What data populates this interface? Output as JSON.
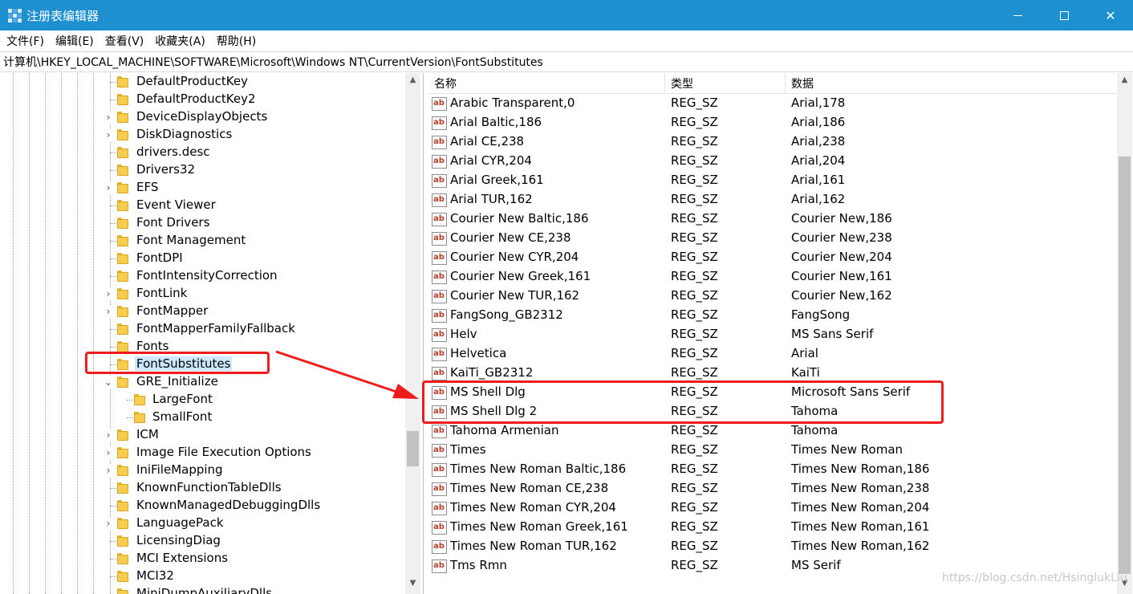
{
  "window": {
    "title": "注册表编辑器",
    "close_glyph": "✕"
  },
  "menu": [
    {
      "label": "文件(F)"
    },
    {
      "label": "编辑(E)"
    },
    {
      "label": "查看(V)"
    },
    {
      "label": "收藏夹(A)"
    },
    {
      "label": "帮助(H)"
    }
  ],
  "address": {
    "path": "计算机\\HKEY_LOCAL_MACHINE\\SOFTWARE\\Microsoft\\Windows NT\\CurrentVersion\\FontSubstitutes"
  },
  "tree": {
    "items": [
      {
        "label": "DefaultProductKey",
        "expandable": false,
        "level": 0
      },
      {
        "label": "DefaultProductKey2",
        "expandable": false,
        "level": 0
      },
      {
        "label": "DeviceDisplayObjects",
        "expandable": true,
        "level": 0
      },
      {
        "label": "DiskDiagnostics",
        "expandable": true,
        "level": 0
      },
      {
        "label": "drivers.desc",
        "expandable": false,
        "level": 0
      },
      {
        "label": "Drivers32",
        "expandable": false,
        "level": 0
      },
      {
        "label": "EFS",
        "expandable": true,
        "level": 0
      },
      {
        "label": "Event Viewer",
        "expandable": false,
        "level": 0
      },
      {
        "label": "Font Drivers",
        "expandable": false,
        "level": 0
      },
      {
        "label": "Font Management",
        "expandable": false,
        "level": 0
      },
      {
        "label": "FontDPI",
        "expandable": false,
        "level": 0
      },
      {
        "label": "FontIntensityCorrection",
        "expandable": false,
        "level": 0
      },
      {
        "label": "FontLink",
        "expandable": true,
        "level": 0
      },
      {
        "label": "FontMapper",
        "expandable": true,
        "level": 0
      },
      {
        "label": "FontMapperFamilyFallback",
        "expandable": false,
        "level": 0
      },
      {
        "label": "Fonts",
        "expandable": false,
        "level": 0
      },
      {
        "label": "FontSubstitutes",
        "expandable": false,
        "level": 0,
        "selected": true
      },
      {
        "label": "GRE_Initialize",
        "expandable": true,
        "expanded": true,
        "level": 0
      },
      {
        "label": "LargeFont",
        "expandable": false,
        "level": 1
      },
      {
        "label": "SmallFont",
        "expandable": false,
        "level": 1
      },
      {
        "label": "ICM",
        "expandable": true,
        "level": 0
      },
      {
        "label": "Image File Execution Options",
        "expandable": true,
        "level": 0
      },
      {
        "label": "IniFileMapping",
        "expandable": true,
        "level": 0
      },
      {
        "label": "KnownFunctionTableDlls",
        "expandable": false,
        "level": 0
      },
      {
        "label": "KnownManagedDebuggingDlls",
        "expandable": false,
        "level": 0
      },
      {
        "label": "LanguagePack",
        "expandable": true,
        "level": 0
      },
      {
        "label": "LicensingDiag",
        "expandable": false,
        "level": 0
      },
      {
        "label": "MCI Extensions",
        "expandable": false,
        "level": 0
      },
      {
        "label": "MCI32",
        "expandable": false,
        "level": 0
      },
      {
        "label": "MiniDumpAuxiliaryDlls",
        "expandable": false,
        "level": 0
      }
    ]
  },
  "list": {
    "columns": {
      "name": "名称",
      "type": "类型",
      "data": "数据"
    },
    "icon_text": "ab",
    "rows": [
      {
        "name": "Arabic Transparent,0",
        "type": "REG_SZ",
        "data": "Arial,178"
      },
      {
        "name": "Arial Baltic,186",
        "type": "REG_SZ",
        "data": "Arial,186"
      },
      {
        "name": "Arial CE,238",
        "type": "REG_SZ",
        "data": "Arial,238"
      },
      {
        "name": "Arial CYR,204",
        "type": "REG_SZ",
        "data": "Arial,204"
      },
      {
        "name": "Arial Greek,161",
        "type": "REG_SZ",
        "data": "Arial,161"
      },
      {
        "name": "Arial TUR,162",
        "type": "REG_SZ",
        "data": "Arial,162"
      },
      {
        "name": "Courier New Baltic,186",
        "type": "REG_SZ",
        "data": "Courier New,186"
      },
      {
        "name": "Courier New CE,238",
        "type": "REG_SZ",
        "data": "Courier New,238"
      },
      {
        "name": "Courier New CYR,204",
        "type": "REG_SZ",
        "data": "Courier New,204"
      },
      {
        "name": "Courier New Greek,161",
        "type": "REG_SZ",
        "data": "Courier New,161"
      },
      {
        "name": "Courier New TUR,162",
        "type": "REG_SZ",
        "data": "Courier New,162"
      },
      {
        "name": "FangSong_GB2312",
        "type": "REG_SZ",
        "data": "FangSong"
      },
      {
        "name": "Helv",
        "type": "REG_SZ",
        "data": "MS Sans Serif"
      },
      {
        "name": "Helvetica",
        "type": "REG_SZ",
        "data": "Arial"
      },
      {
        "name": "KaiTi_GB2312",
        "type": "REG_SZ",
        "data": "KaiTi"
      },
      {
        "name": "MS Shell Dlg",
        "type": "REG_SZ",
        "data": "Microsoft Sans Serif"
      },
      {
        "name": "MS Shell Dlg 2",
        "type": "REG_SZ",
        "data": "Tahoma"
      },
      {
        "name": "Tahoma Armenian",
        "type": "REG_SZ",
        "data": "Tahoma"
      },
      {
        "name": "Times",
        "type": "REG_SZ",
        "data": "Times New Roman"
      },
      {
        "name": "Times New Roman Baltic,186",
        "type": "REG_SZ",
        "data": "Times New Roman,186"
      },
      {
        "name": "Times New Roman CE,238",
        "type": "REG_SZ",
        "data": "Times New Roman,238"
      },
      {
        "name": "Times New Roman CYR,204",
        "type": "REG_SZ",
        "data": "Times New Roman,204"
      },
      {
        "name": "Times New Roman Greek,161",
        "type": "REG_SZ",
        "data": "Times New Roman,161"
      },
      {
        "name": "Times New Roman TUR,162",
        "type": "REG_SZ",
        "data": "Times New Roman,162"
      },
      {
        "name": "Tms Rmn",
        "type": "REG_SZ",
        "data": "MS Serif"
      }
    ]
  },
  "watermark": "https://blog.csdn.net/HsinglukLiu",
  "colors": {
    "titlebar": "#1e90cf",
    "selection": "#cce8ff",
    "annotation_red": "#ee1c1c",
    "folder": "#f7cd50"
  }
}
